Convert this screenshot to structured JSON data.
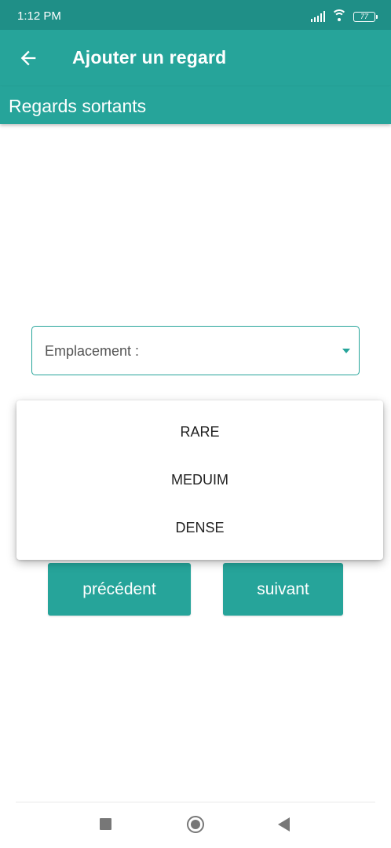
{
  "status_bar": {
    "time": "1:12 PM",
    "battery_level": "77",
    "icons": [
      "signal-icon",
      "wifi-icon",
      "battery-icon"
    ]
  },
  "app_bar": {
    "back_icon": "arrow-left-icon",
    "title": "Ajouter un regard"
  },
  "sub_header": {
    "title": "Regards sortants"
  },
  "form": {
    "spinner": {
      "label": "Emplacement :",
      "arrow_icon": "triangle-down-icon"
    },
    "buttons": {
      "previous_label": "précédent",
      "next_label": "suivant"
    }
  },
  "dropdown": {
    "options": [
      {
        "label": "RARE"
      },
      {
        "label": "MEDUIM"
      },
      {
        "label": "DENSE"
      }
    ]
  },
  "nav_bar": {
    "icons": [
      "recents-square-icon",
      "home-circle-icon",
      "back-triangle-icon"
    ]
  },
  "colors": {
    "status_bar": "#1f8f87",
    "primary": "#26a49a",
    "on_primary": "#ffffff",
    "nav_icon": "#777777"
  }
}
